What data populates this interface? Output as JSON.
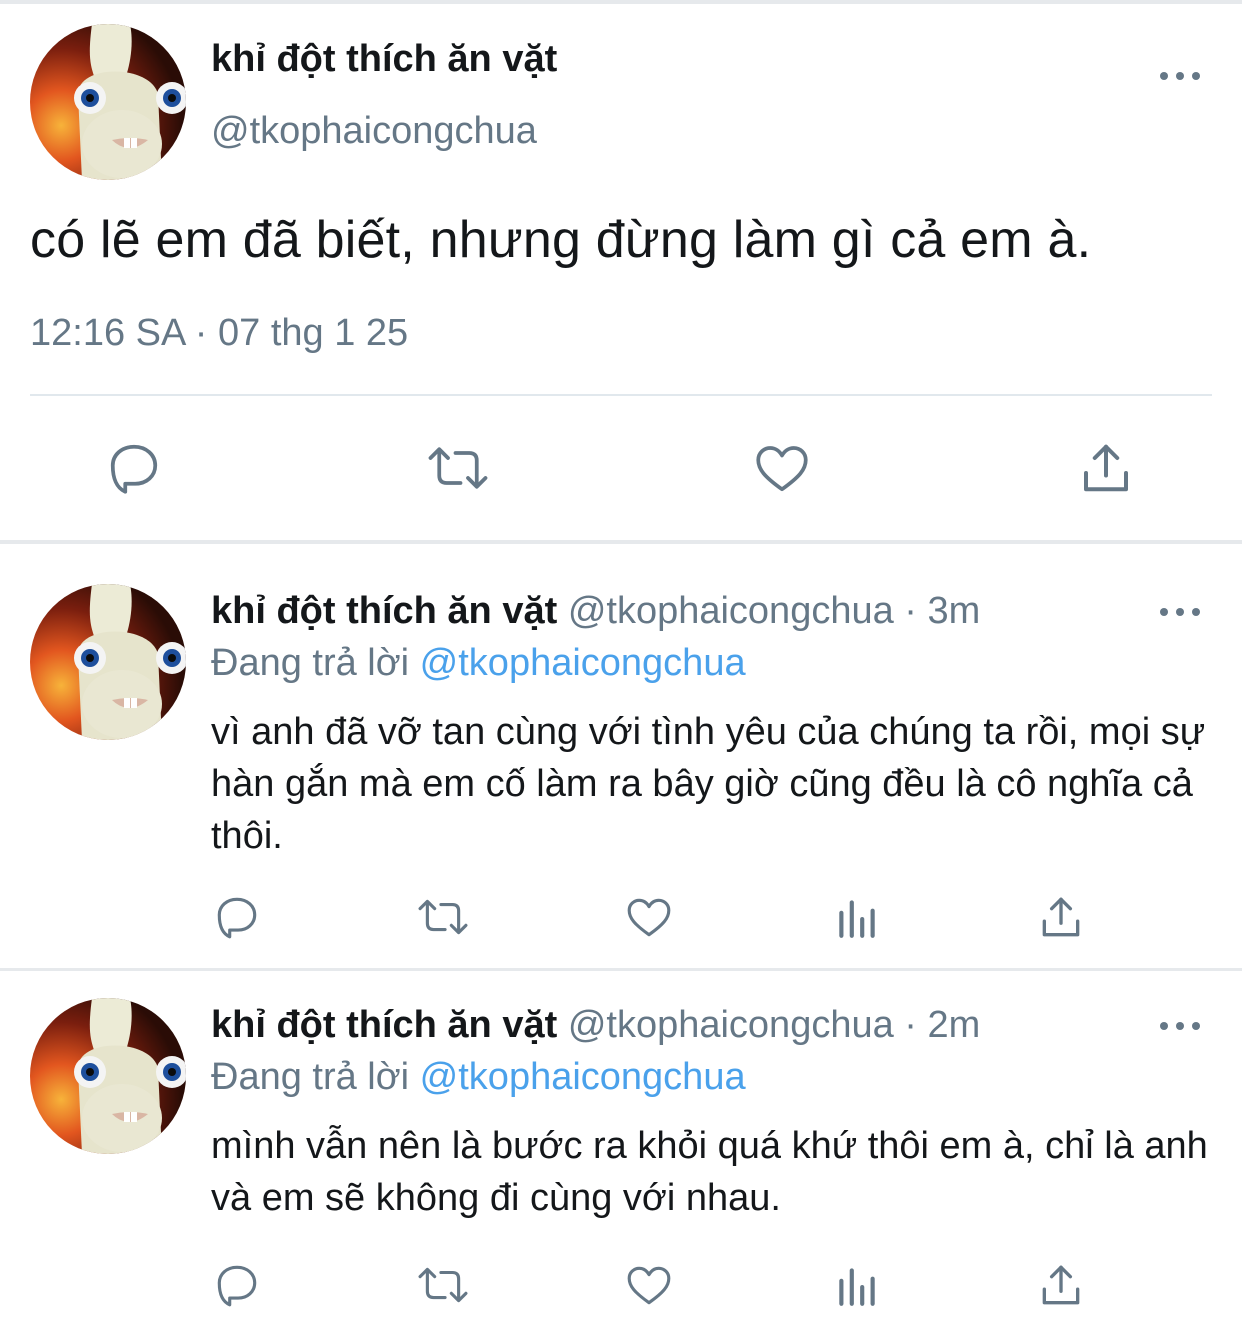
{
  "main_tweet": {
    "author_name": "khỉ đột thích ăn vặt",
    "author_handle": "@tkophaicongchua",
    "text": "có lẽ em đã biết, nhưng đừng làm gì cả em à.",
    "timestamp": "12:16 SA · 07 thg 1 25",
    "actions": [
      "reply-icon",
      "retweet-icon",
      "like-icon",
      "share-icon"
    ]
  },
  "replies": [
    {
      "author_name": "khỉ đột thích ăn vặt",
      "author_handle": "@tkophaicongchua",
      "separator": "·",
      "time": "3m",
      "replying_label": "Đang trả lời",
      "replying_to": "@tkophaicongchua",
      "text": "vì anh đã vỡ tan cùng với tình yêu của chúng ta rồi, mọi sự hàn gắn mà em cố làm ra bây giờ cũng đều là cô nghĩa cả thôi."
    },
    {
      "author_name": "khỉ đột thích ăn vặt",
      "author_handle": "@tkophaicongchua",
      "separator": "·",
      "time": "2m",
      "replying_label": "Đang trả lời",
      "replying_to": "@tkophaicongchua",
      "text": "mình vẫn nên là bước ra khỏi quá khứ thôi em à, chỉ là anh và em sẽ không đi cùng với nhau."
    }
  ],
  "colors": {
    "text_primary": "#14171a",
    "text_secondary": "#657786",
    "link": "#4aa1eb",
    "divider": "#e1e8ed"
  }
}
